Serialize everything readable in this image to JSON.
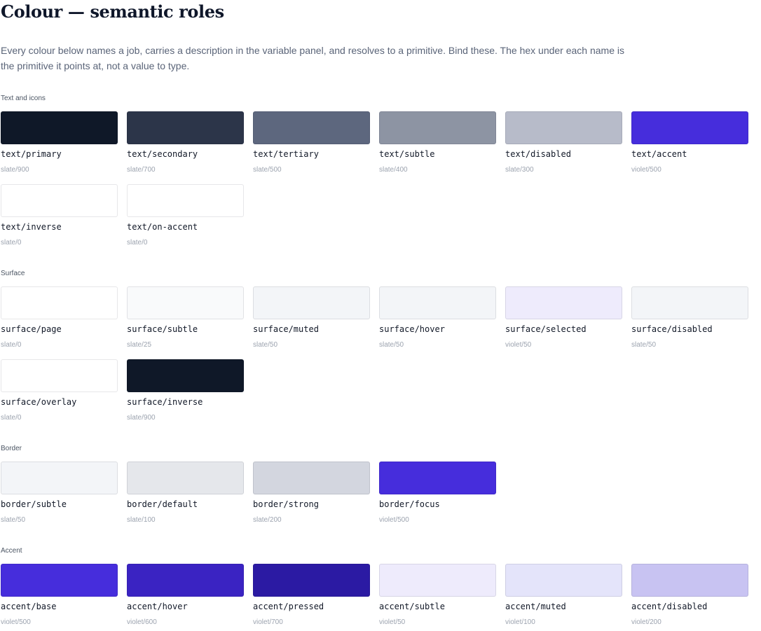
{
  "page": {
    "title": "Colour — semantic roles",
    "intro": "Every colour below names a job, carries a description in the variable panel, and resolves to a primitive. Bind these. The hex under each name is the primitive it points at, not a value to type."
  },
  "sections": [
    {
      "label": "Text and icons",
      "tokens": [
        {
          "name": "text/primary",
          "ref": "slate/900",
          "color": "#0f1828"
        },
        {
          "name": "text/secondary",
          "ref": "slate/700",
          "color": "#2c3549"
        },
        {
          "name": "text/tertiary",
          "ref": "slate/500",
          "color": "#5d677e"
        },
        {
          "name": "text/subtle",
          "ref": "slate/400",
          "color": "#8d94a3"
        },
        {
          "name": "text/disabled",
          "ref": "slate/300",
          "color": "#b7bbc9"
        },
        {
          "name": "text/accent",
          "ref": "violet/500",
          "color": "#462ddc"
        },
        {
          "name": "text/inverse",
          "ref": "slate/0",
          "color": "#ffffff"
        },
        {
          "name": "text/on-accent",
          "ref": "slate/0",
          "color": "#ffffff"
        }
      ]
    },
    {
      "label": "Surface",
      "tokens": [
        {
          "name": "surface/page",
          "ref": "slate/0",
          "color": "#ffffff"
        },
        {
          "name": "surface/subtle",
          "ref": "slate/25",
          "color": "#f9fafb"
        },
        {
          "name": "surface/muted",
          "ref": "slate/50",
          "color": "#f3f5f8"
        },
        {
          "name": "surface/hover",
          "ref": "slate/50",
          "color": "#f3f5f8"
        },
        {
          "name": "surface/selected",
          "ref": "violet/50",
          "color": "#eeebfc"
        },
        {
          "name": "surface/disabled",
          "ref": "slate/50",
          "color": "#f3f5f8"
        },
        {
          "name": "surface/overlay",
          "ref": "slate/0",
          "color": "#ffffff"
        },
        {
          "name": "surface/inverse",
          "ref": "slate/900",
          "color": "#0f1828"
        }
      ]
    },
    {
      "label": "Border",
      "tokens": [
        {
          "name": "border/subtle",
          "ref": "slate/50",
          "color": "#f3f5f8"
        },
        {
          "name": "border/default",
          "ref": "slate/100",
          "color": "#e5e7eb"
        },
        {
          "name": "border/strong",
          "ref": "slate/200",
          "color": "#d3d6df"
        },
        {
          "name": "border/focus",
          "ref": "violet/500",
          "color": "#462ddc"
        }
      ]
    },
    {
      "label": "Accent",
      "tokens": [
        {
          "name": "accent/base",
          "ref": "violet/500",
          "color": "#462ddc"
        },
        {
          "name": "accent/hover",
          "ref": "violet/600",
          "color": "#3a23c2"
        },
        {
          "name": "accent/pressed",
          "ref": "violet/700",
          "color": "#2b1aa3"
        },
        {
          "name": "accent/subtle",
          "ref": "violet/50",
          "color": "#eeebfc"
        },
        {
          "name": "accent/muted",
          "ref": "violet/100",
          "color": "#e4e4fa"
        },
        {
          "name": "accent/disabled",
          "ref": "violet/200",
          "color": "#c8c3f2"
        }
      ]
    }
  ]
}
